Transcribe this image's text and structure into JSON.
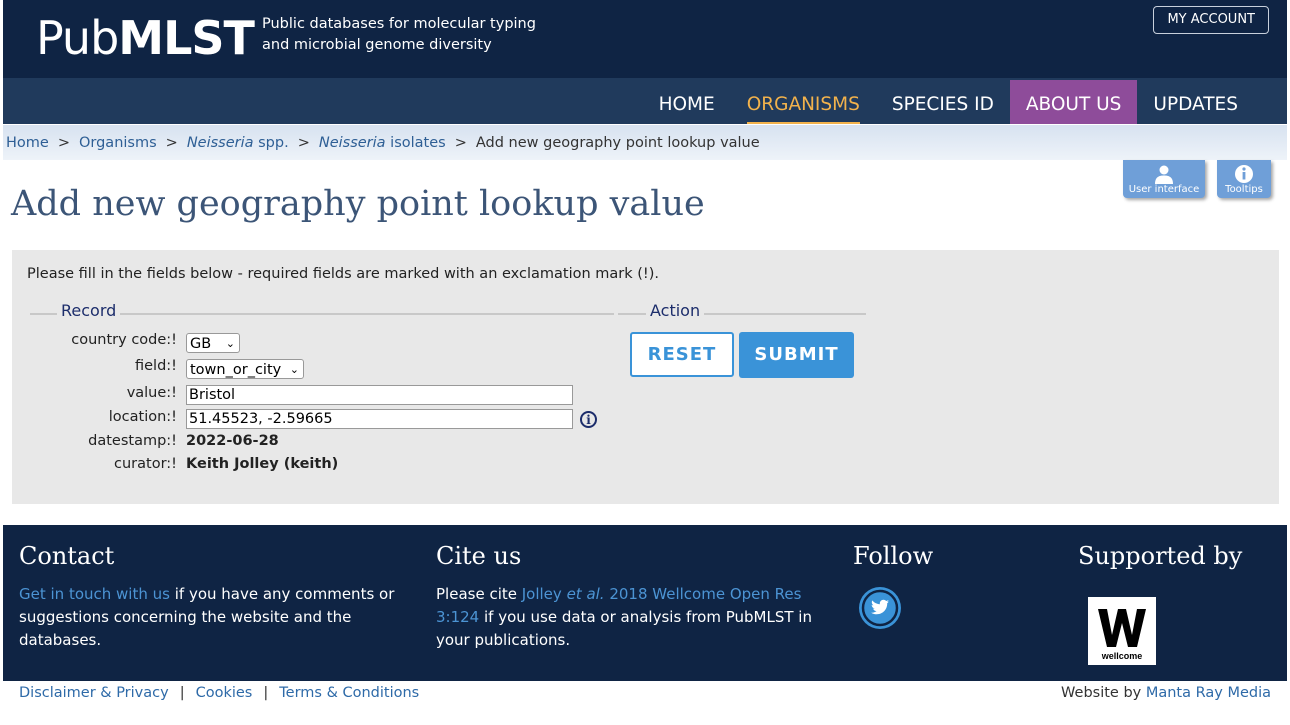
{
  "header": {
    "logo_pub": "Pub",
    "logo_mlst": "MLST",
    "tagline_line1": "Public databases for molecular typing",
    "tagline_line2": "and microbial genome diversity",
    "account_label": "MY ACCOUNT"
  },
  "nav": {
    "items": [
      {
        "label": "HOME",
        "state": "normal"
      },
      {
        "label": "ORGANISMS",
        "state": "active"
      },
      {
        "label": "SPECIES ID",
        "state": "normal"
      },
      {
        "label": "ABOUT US",
        "state": "highlight"
      },
      {
        "label": "UPDATES",
        "state": "normal"
      }
    ]
  },
  "breadcrumb": {
    "home": "Home",
    "organisms": "Organisms",
    "genus1": "Neisseria",
    "genus1_suffix": " spp.",
    "genus2": "Neisseria",
    "genus2_suffix": " isolates",
    "current": "Add new geography point lookup value",
    "separator": ">"
  },
  "tools": {
    "user_interface": "User interface",
    "tooltips": "Tooltips"
  },
  "page": {
    "title": "Add new geography point lookup value",
    "instructions": "Please fill in the fields below - required fields are marked with an exclamation mark (!)."
  },
  "form": {
    "record_legend": "Record",
    "action_legend": "Action",
    "country_code_label": "country code:!",
    "country_code_value": "GB",
    "field_label": "field:!",
    "field_value": "town_or_city",
    "value_label": "value:!",
    "value_value": "Bristol",
    "location_label": "location:!",
    "location_value": "51.45523, -2.59665",
    "datestamp_label": "datestamp:!",
    "datestamp_value": "2022-06-28",
    "curator_label": "curator:!",
    "curator_value": "Keith Jolley (keith)",
    "reset_label": "RESET",
    "submit_label": "SUBMIT"
  },
  "footer": {
    "contact_title": "Contact",
    "contact_link": "Get in touch with us",
    "contact_text": " if you have any comments or suggestions concerning the website and the databases.",
    "cite_title": "Cite us",
    "cite_prefix": "Please cite ",
    "cite_link_a": "Jolley ",
    "cite_link_b": "et al.",
    "cite_link_c": " 2018 Wellcome Open Res 3:124",
    "cite_suffix": " if you use data or analysis from PubMLST in your publications.",
    "follow_title": "Follow",
    "supported_title": "Supported by",
    "wellcome_text": "wellcome",
    "disclaimer": "Disclaimer & Privacy",
    "cookies": "Cookies",
    "terms": "Terms & Conditions",
    "separator": "|",
    "website_by": "Website by ",
    "agency": "Manta Ray Media"
  },
  "colors": {
    "header_bg": "#0f2444",
    "nav_bg": "#203a5c",
    "nav_active": "#f2b24c",
    "nav_highlight": "#8e4c9a",
    "button_blue": "#3a93d8",
    "link_blue": "#2e5f95"
  },
  "icons": [
    "user-icon",
    "info-icon",
    "chevron-down-icon",
    "twitter-icon",
    "wellcome-logo"
  ]
}
